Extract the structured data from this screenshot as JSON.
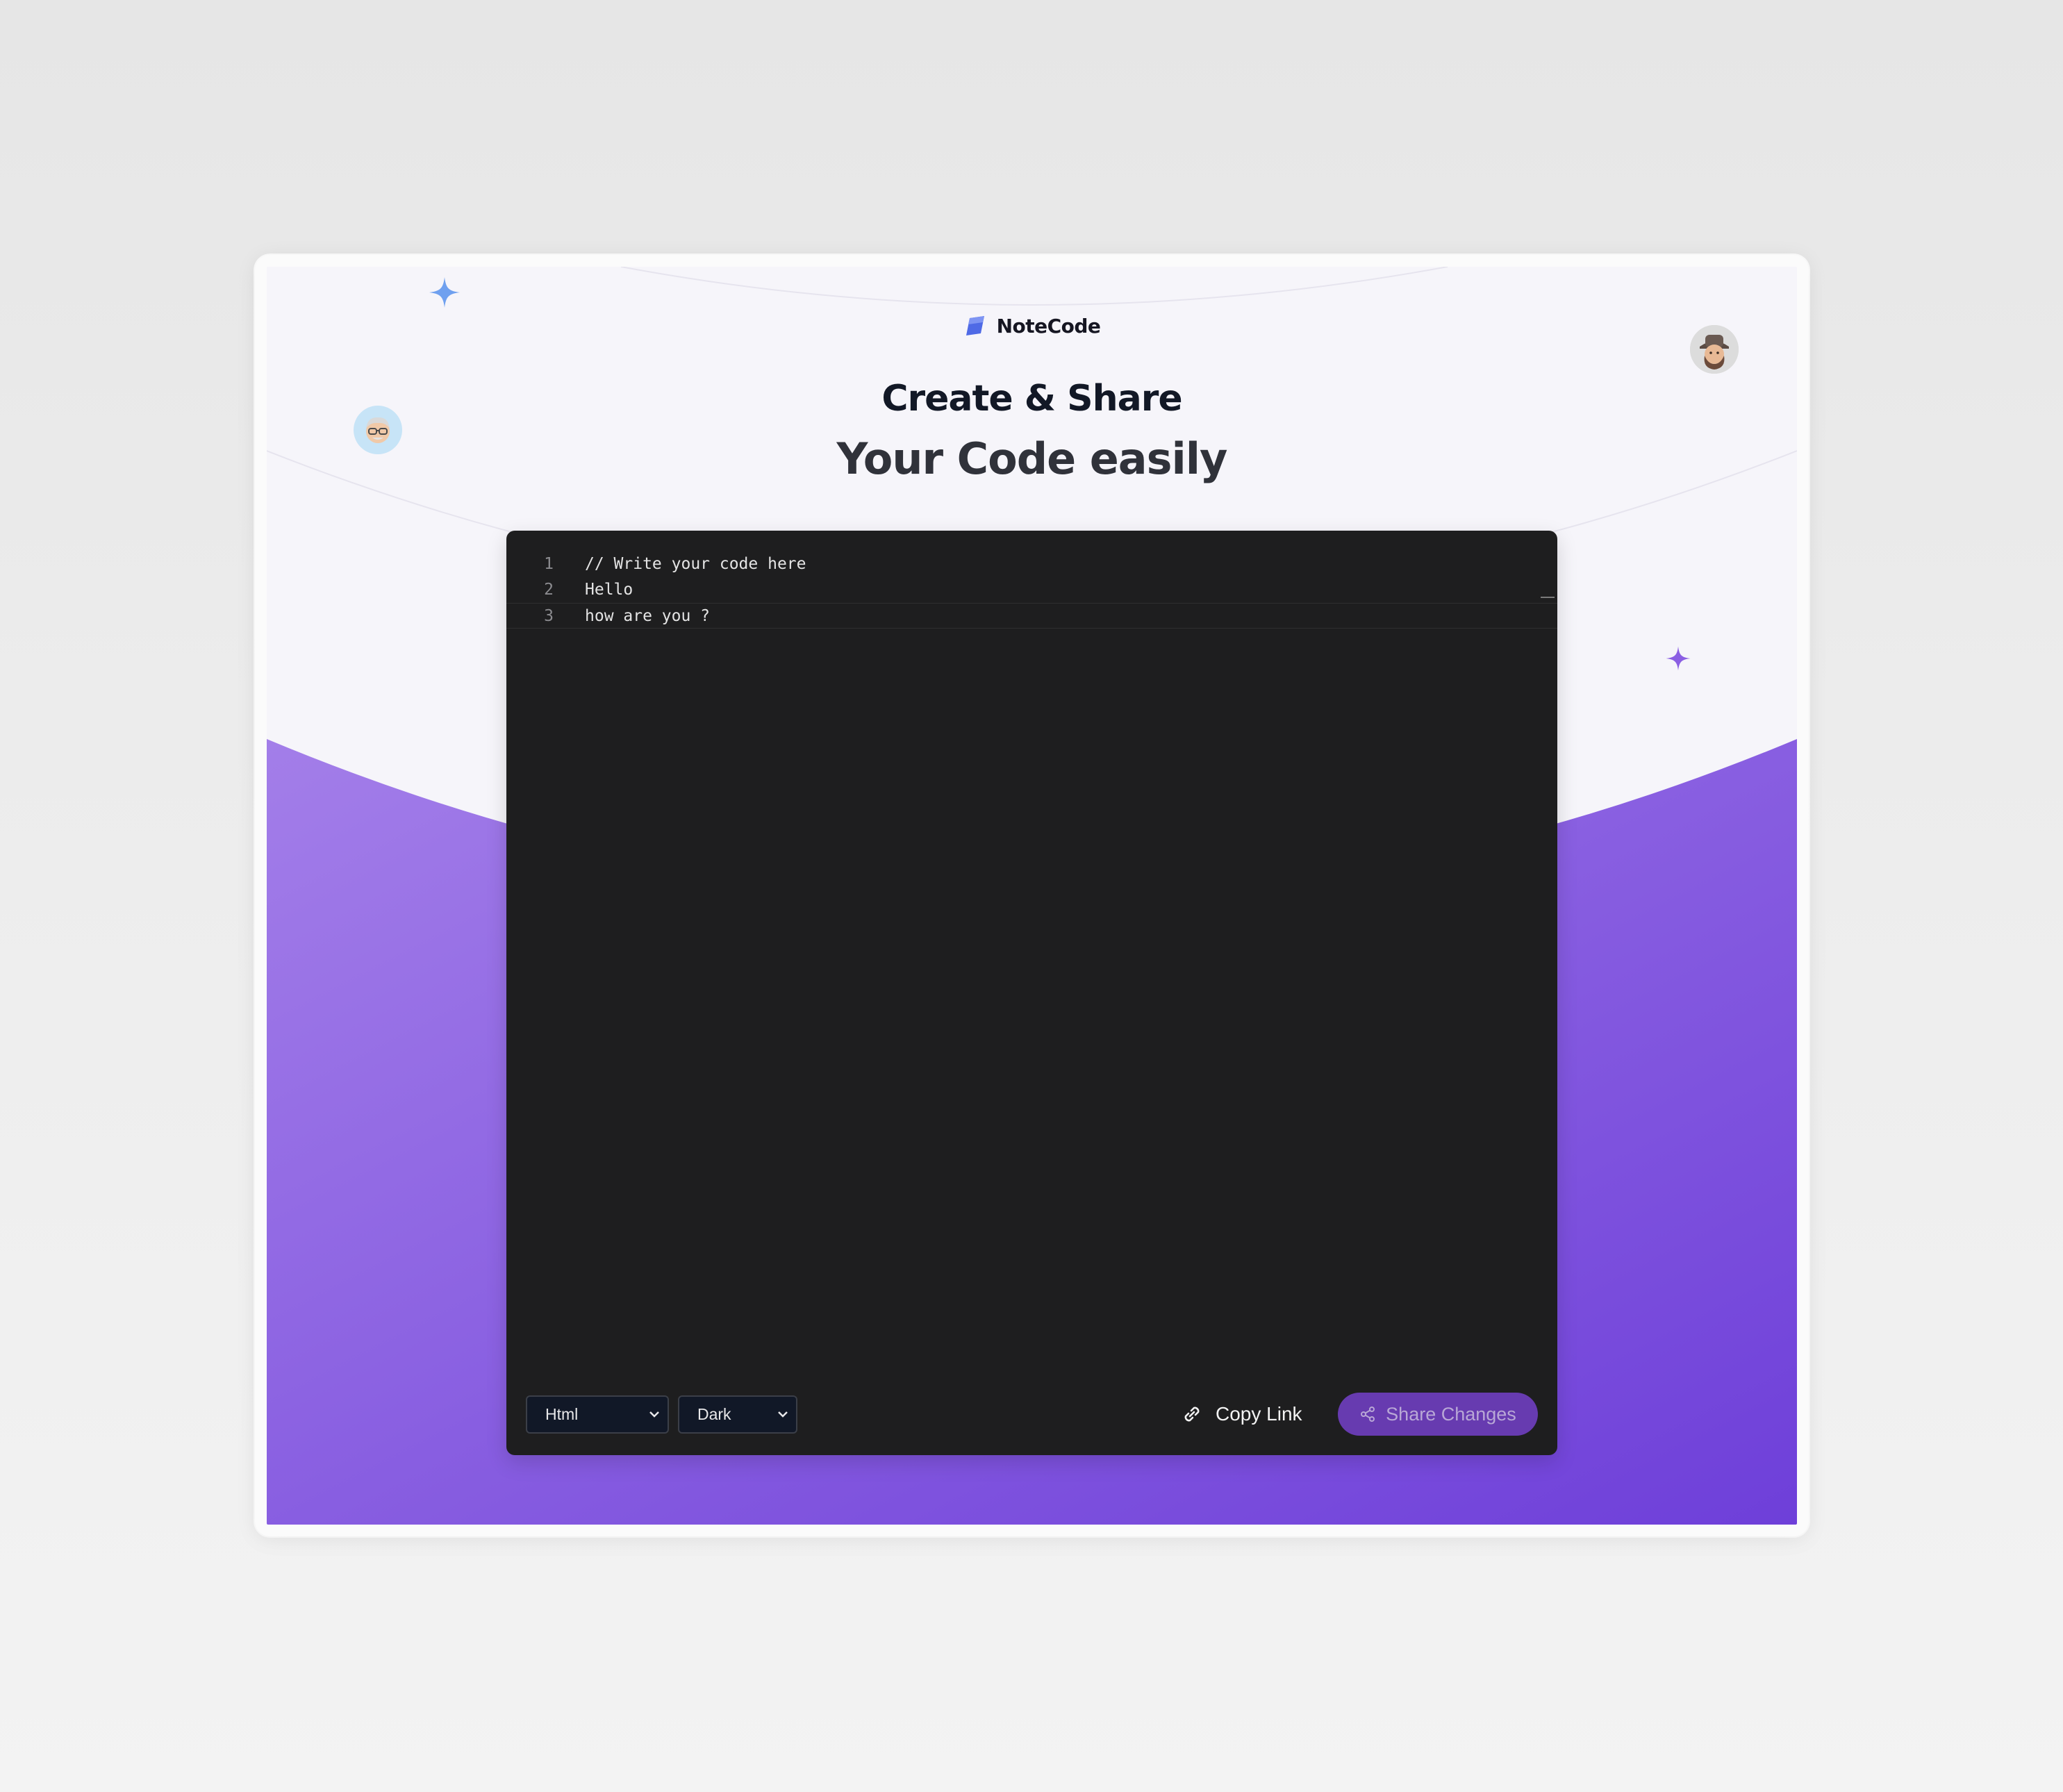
{
  "brand": {
    "name": "NoteCode",
    "logo_icon": "notecode-logo-icon"
  },
  "hero": {
    "line1": "Create & Share",
    "line2": "Your Code easily"
  },
  "editor": {
    "lines": [
      {
        "number": "1",
        "text": "// Write your code here"
      },
      {
        "number": "2",
        "text": "Hello"
      },
      {
        "number": "3",
        "text": "how are you ?"
      }
    ],
    "active_line": 3
  },
  "controls": {
    "language_select": {
      "value": "Html"
    },
    "theme_select": {
      "value": "Dark"
    },
    "copy_link_label": "Copy Link",
    "share_label": "Share Changes"
  },
  "colors": {
    "accent_purple": "#7b4fe0",
    "share_button": "#673bb0",
    "editor_bg": "#1e1e1f",
    "brand_blue": "#5571ee"
  }
}
